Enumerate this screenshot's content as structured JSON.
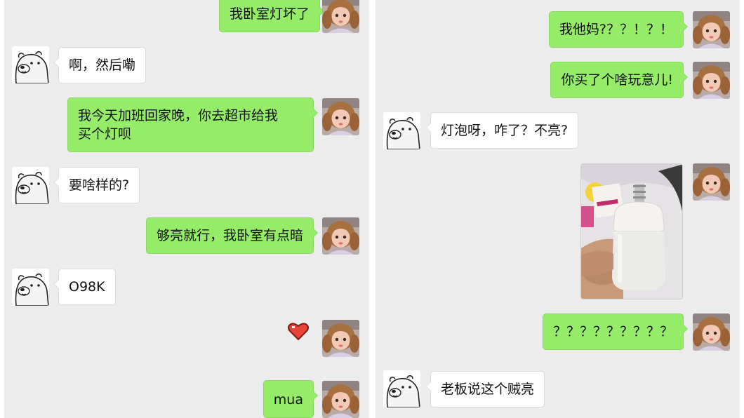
{
  "colors": {
    "chat_background": "#ececec",
    "outgoing_bubble": "#95ec69",
    "incoming_bubble": "#ffffff",
    "heart": "#e8443a"
  },
  "left_chat": {
    "messages": [
      {
        "from": "me",
        "text": "我卧室灯坏了"
      },
      {
        "from": "bear",
        "text": "啊，然后嘞"
      },
      {
        "from": "me",
        "lines": [
          "我今天加班回家晚，你去超市给我",
          "买个灯呗"
        ]
      },
      {
        "from": "bear",
        "text": "要啥样的?"
      },
      {
        "from": "me",
        "text": "够亮就行，我卧室有点暗"
      },
      {
        "from": "bear",
        "text": "O98K"
      },
      {
        "from": "me",
        "type": "heart-sticker",
        "icon": "heart-icon"
      },
      {
        "from": "me",
        "text": "mua"
      }
    ]
  },
  "right_chat": {
    "messages": [
      {
        "from": "me",
        "text": "我他妈?？？！？！"
      },
      {
        "from": "me",
        "text": "你买了个啥玩意儿!"
      },
      {
        "from": "bear",
        "text": "灯泡呀，咋了？不亮?"
      },
      {
        "from": "me",
        "type": "photo",
        "description_icon": "light-bulb-photo"
      },
      {
        "from": "me",
        "text": "？？？？？？？？？"
      },
      {
        "from": "bear",
        "text": "老板说这个贼亮"
      }
    ]
  }
}
